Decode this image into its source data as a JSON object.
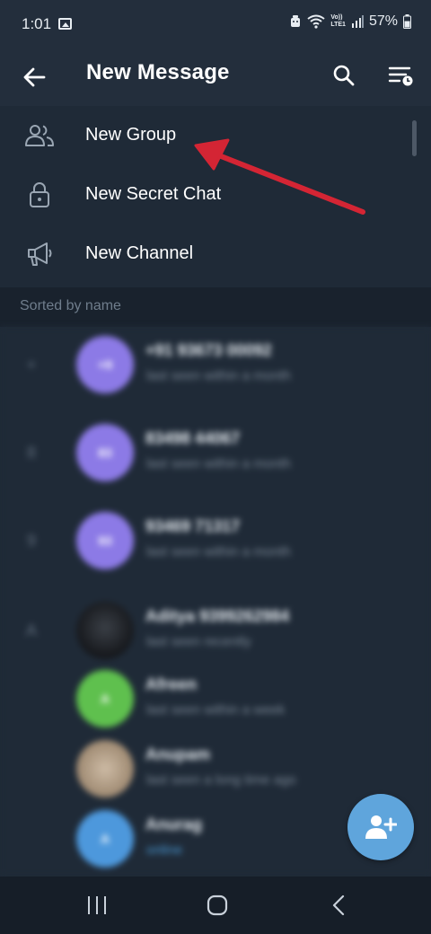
{
  "status_bar": {
    "time": "1:01",
    "volte_top": "Vo))",
    "volte_bottom": "LTE1",
    "battery": "57%"
  },
  "toolbar": {
    "title": "New Message",
    "back_icon": "arrow-left-icon",
    "search_icon": "search-icon",
    "sort_icon": "sort-menu-icon"
  },
  "actions": [
    {
      "label": "New Group",
      "icon": "people-icon"
    },
    {
      "label": "New Secret Chat",
      "icon": "lock-icon"
    },
    {
      "label": "New Channel",
      "icon": "megaphone-icon"
    }
  ],
  "section_header": "Sorted by name",
  "contacts": [
    {
      "letter": "+",
      "initials": "+9",
      "name": "+91 93673 00092",
      "status": "last seen within a month",
      "avatar_color": "#8c7ae6"
    },
    {
      "letter": "8",
      "initials": "83",
      "name": "83498 44067",
      "status": "last seen within a month",
      "avatar_color": "#8c7ae6"
    },
    {
      "letter": "9",
      "initials": "93",
      "name": "93469 71317",
      "status": "last seen within a month",
      "avatar_color": "#8c7ae6"
    },
    {
      "letter": "A",
      "initials": "",
      "name": "Aditya 9399262984",
      "status": "last seen recently",
      "avatar_color": "#22252b"
    },
    {
      "letter": "",
      "initials": "A",
      "name": "Afreen",
      "status": "last seen within a week",
      "avatar_color": "#5fc04e"
    },
    {
      "letter": "",
      "initials": "",
      "name": "Anupam",
      "status": "last seen a long time ago",
      "avatar_color": "#b9a48e"
    },
    {
      "letter": "",
      "initials": "A",
      "name": "Anurag",
      "status": "online",
      "avatar_color": "#4d98dc"
    }
  ],
  "colors": {
    "background": "#1f2a37",
    "header": "#232e3c",
    "accent": "#5fa5dc",
    "annotation_arrow": "#d42534"
  }
}
